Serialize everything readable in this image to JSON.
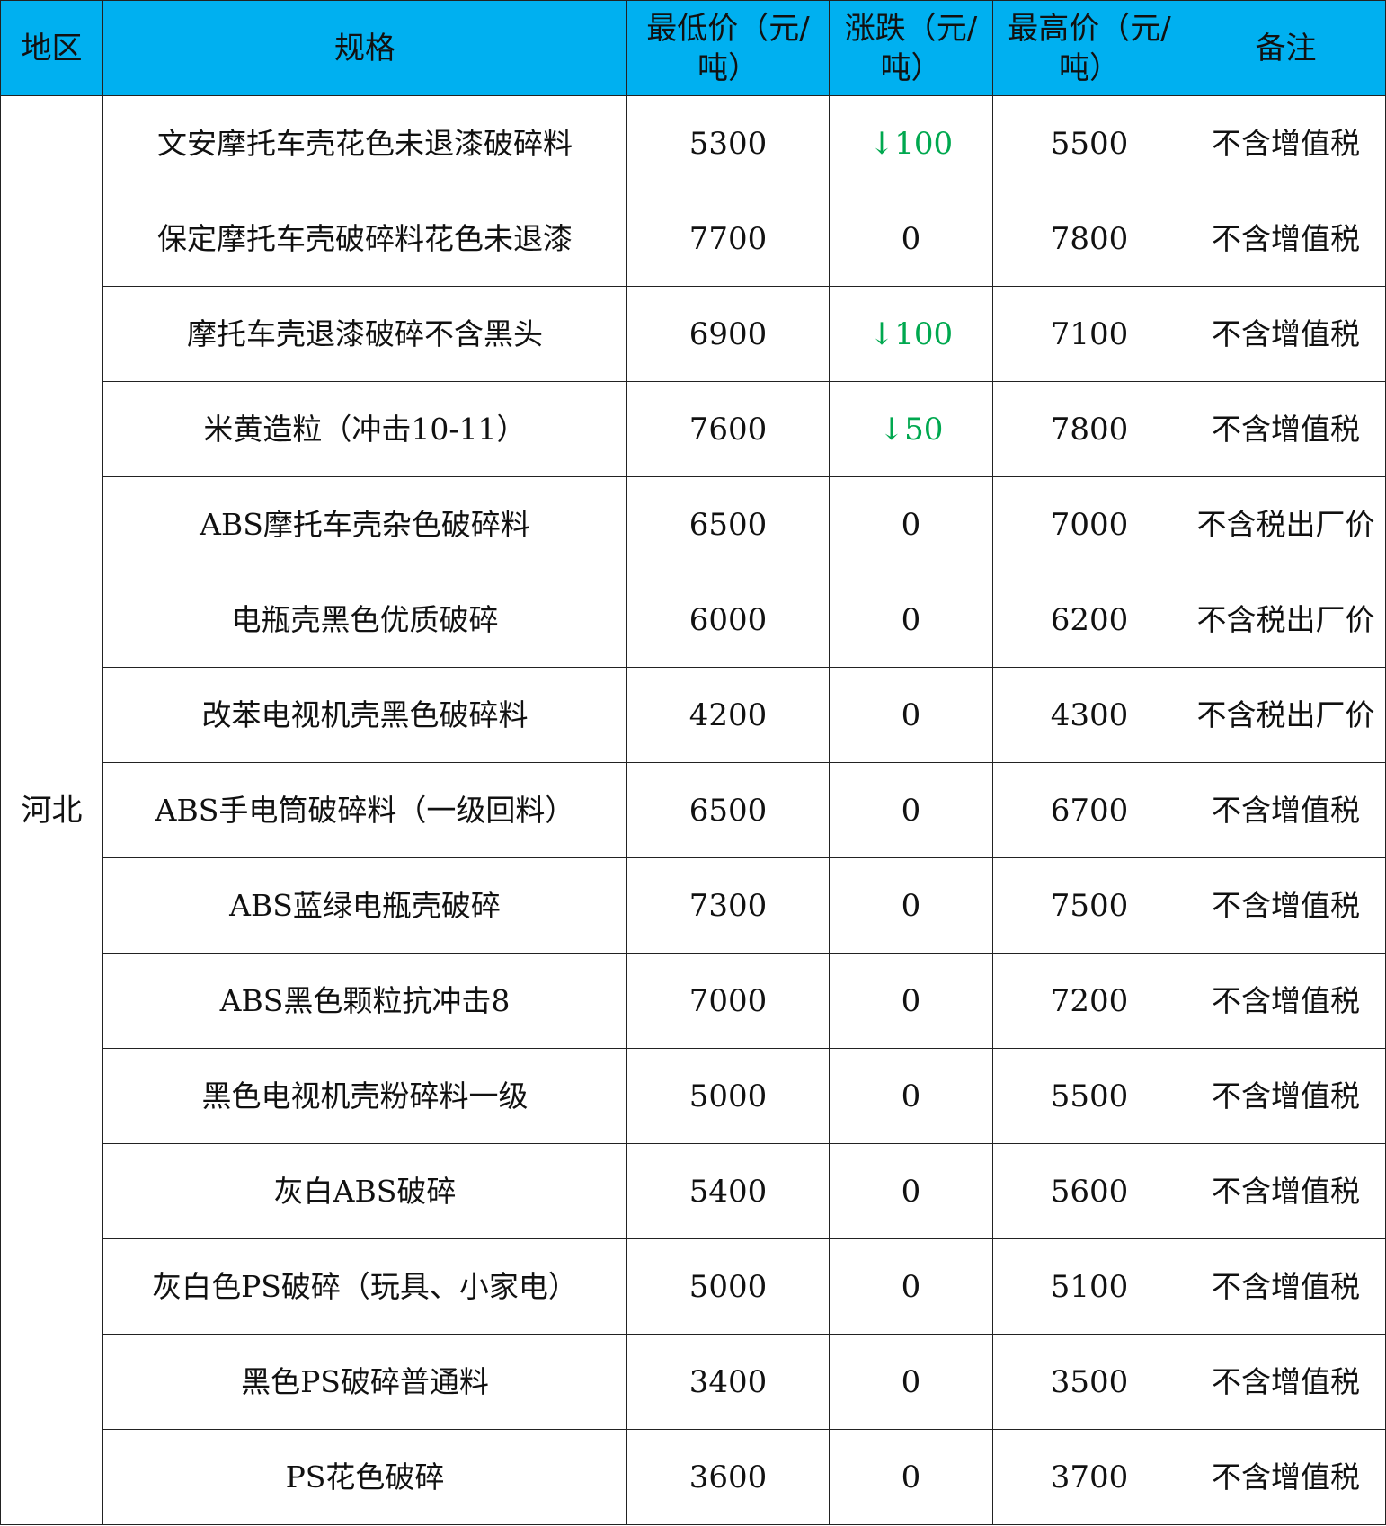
{
  "table": {
    "headers": {
      "region": "地区",
      "spec": "规格",
      "min_price": "最低价（元/吨）",
      "change": "涨跌（元/吨）",
      "max_price": "最高价（元/吨）",
      "note": "备注"
    },
    "region": "河北",
    "rows": [
      {
        "spec": "文安摩托车壳花色未退漆破碎料",
        "min": "5300",
        "change": "↓100",
        "change_dir": "down",
        "max": "5500",
        "note": "不含增值税"
      },
      {
        "spec": "保定摩托车壳破碎料花色未退漆",
        "min": "7700",
        "change": "0",
        "change_dir": "flat",
        "max": "7800",
        "note": "不含增值税"
      },
      {
        "spec": "摩托车壳退漆破碎不含黑头",
        "min": "6900",
        "change": "↓100",
        "change_dir": "down",
        "max": "7100",
        "note": "不含增值税"
      },
      {
        "spec": "米黄造粒（冲击10-11）",
        "min": "7600",
        "change": "↓50",
        "change_dir": "down",
        "max": "7800",
        "note": "不含增值税"
      },
      {
        "spec": "ABS摩托车壳杂色破碎料",
        "min": "6500",
        "change": "0",
        "change_dir": "flat",
        "max": "7000",
        "note": "不含税出厂价"
      },
      {
        "spec": "电瓶壳黑色优质破碎",
        "min": "6000",
        "change": "0",
        "change_dir": "flat",
        "max": "6200",
        "note": "不含税出厂价"
      },
      {
        "spec": "改苯电视机壳黑色破碎料",
        "min": "4200",
        "change": "0",
        "change_dir": "flat",
        "max": "4300",
        "note": "不含税出厂价"
      },
      {
        "spec": "ABS手电筒破碎料（一级回料）",
        "min": "6500",
        "change": "0",
        "change_dir": "flat",
        "max": "6700",
        "note": "不含增值税"
      },
      {
        "spec": "ABS蓝绿电瓶壳破碎",
        "min": "7300",
        "change": "0",
        "change_dir": "flat",
        "max": "7500",
        "note": "不含增值税"
      },
      {
        "spec": "ABS黑色颗粒抗冲击8",
        "min": "7000",
        "change": "0",
        "change_dir": "flat",
        "max": "7200",
        "note": "不含增值税"
      },
      {
        "spec": "黑色电视机壳粉碎料一级",
        "min": "5000",
        "change": "0",
        "change_dir": "flat",
        "max": "5500",
        "note": "不含增值税"
      },
      {
        "spec": "灰白ABS破碎",
        "min": "5400",
        "change": "0",
        "change_dir": "flat",
        "max": "5600",
        "note": "不含增值税"
      },
      {
        "spec": "灰白色PS破碎（玩具、小家电）",
        "min": "5000",
        "change": "0",
        "change_dir": "flat",
        "max": "5100",
        "note": "不含增值税"
      },
      {
        "spec": "黑色PS破碎普通料",
        "min": "3400",
        "change": "0",
        "change_dir": "flat",
        "max": "3500",
        "note": "不含增值税"
      },
      {
        "spec": "PS花色破碎",
        "min": "3600",
        "change": "0",
        "change_dir": "flat",
        "max": "3700",
        "note": "不含增值税"
      }
    ]
  },
  "colors": {
    "header_bg": "#00b0f0",
    "down_change": "#00a84f",
    "border": "#222222"
  }
}
